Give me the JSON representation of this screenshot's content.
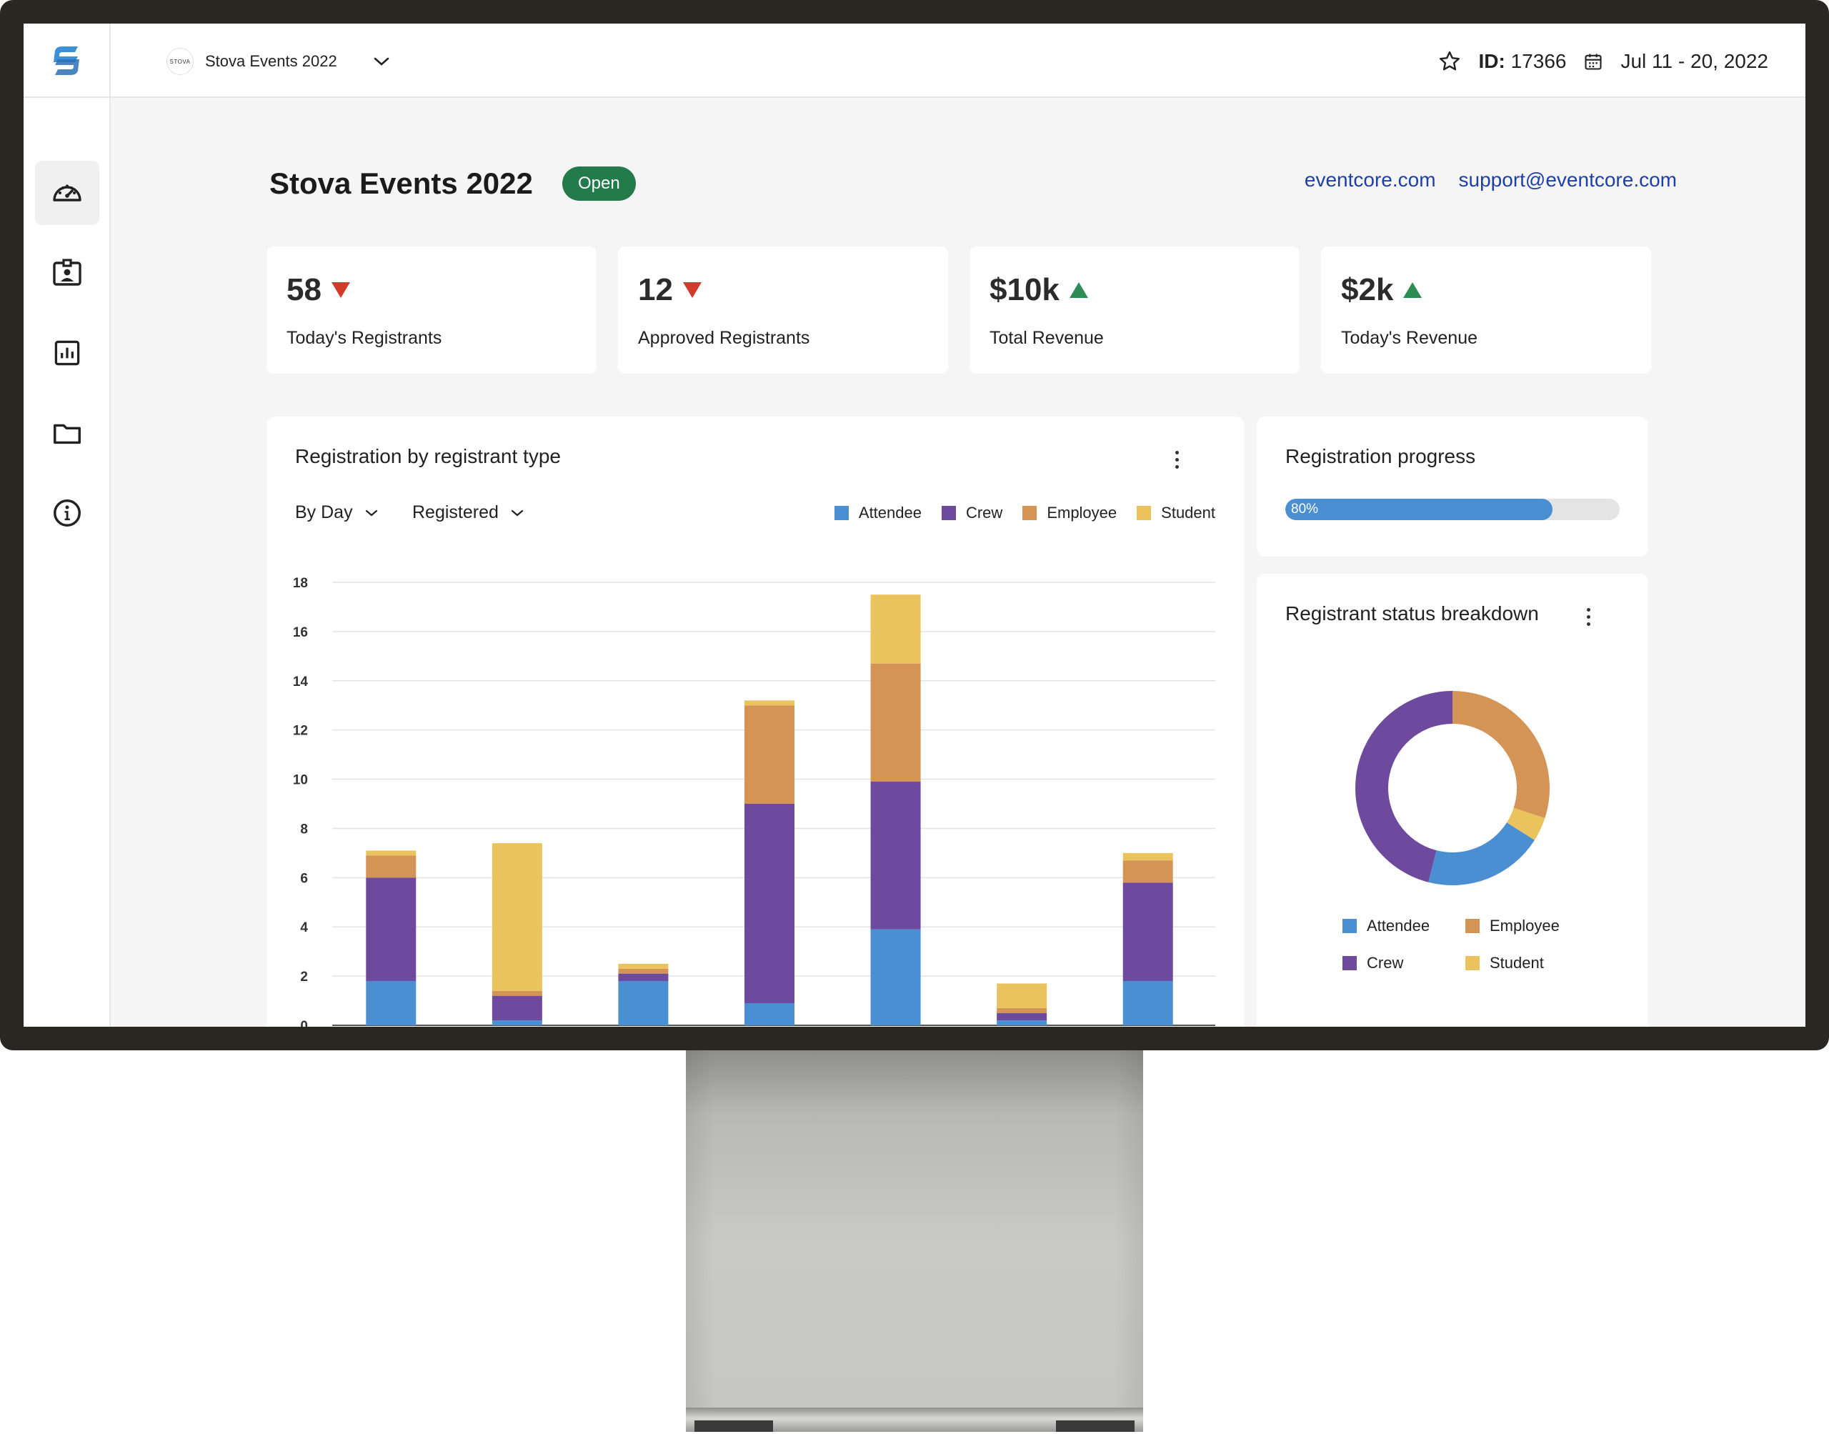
{
  "app": {
    "event_selector": {
      "logo_text": "STOVA",
      "label": "Stova Events 2022"
    },
    "id_label": "ID:",
    "id_value": "17366",
    "date_range": "Jul 11 - 20, 2022"
  },
  "sidebar": {
    "items": [
      {
        "icon": "dashboard-gauge-icon",
        "active": true
      },
      {
        "icon": "id-badge-icon",
        "active": false
      },
      {
        "icon": "report-chart-icon",
        "active": false
      },
      {
        "icon": "folder-icon",
        "active": false
      },
      {
        "icon": "info-icon",
        "active": false
      }
    ]
  },
  "header": {
    "title": "Stova Events 2022",
    "status": "Open",
    "links": [
      "eventcore.com",
      "support@eventcore.com"
    ]
  },
  "stats": [
    {
      "value": "58",
      "label": "Today's Registrants",
      "trend": "down"
    },
    {
      "value": "12",
      "label": "Approved Registrants",
      "trend": "down"
    },
    {
      "value": "$10k",
      "label": "Total Revenue",
      "trend": "up"
    },
    {
      "value": "$2k",
      "label": "Today's Revenue",
      "trend": "up"
    }
  ],
  "colors": {
    "attendee": "#4a8fd1",
    "crew": "#6e4a9e",
    "employee": "#d39456",
    "student": "#ebc35e",
    "trend_down": "#d23a2c",
    "trend_up": "#2f8c55",
    "status_open": "#237a4b",
    "link": "#1f3fa8"
  },
  "registration_card": {
    "title": "Registration by registrant type",
    "filter_period": "By Day",
    "filter_status": "Registered",
    "legend": [
      "Attendee",
      "Crew",
      "Employee",
      "Student"
    ]
  },
  "progress_card": {
    "title": "Registration progress",
    "percent": 80,
    "percent_label": "80%"
  },
  "status_card": {
    "title": "Registrant status breakdown",
    "legend": [
      "Attendee",
      "Employee",
      "Crew",
      "Student"
    ]
  },
  "chart_data": [
    {
      "type": "bar",
      "stacked": true,
      "title": "Registration by registrant type",
      "ylim": [
        0,
        18
      ],
      "yticks": [
        0,
        2,
        4,
        6,
        8,
        10,
        12,
        14,
        16,
        18
      ],
      "grid": true,
      "legend_position": "top-right",
      "series": [
        {
          "name": "Attendee",
          "color": "#4a8fd1",
          "values": [
            1.8,
            0.2,
            1.8,
            0.9,
            3.9,
            0.2,
            1.8
          ]
        },
        {
          "name": "Crew",
          "color": "#6e4a9e",
          "values": [
            4.2,
            1.0,
            0.3,
            8.1,
            6.0,
            0.3,
            4.0
          ]
        },
        {
          "name": "Employee",
          "color": "#d39456",
          "values": [
            0.9,
            0.2,
            0.2,
            4.0,
            4.8,
            0.2,
            0.9
          ]
        },
        {
          "name": "Student",
          "color": "#ebc35e",
          "values": [
            0.2,
            6.0,
            0.2,
            0.2,
            2.8,
            1.0,
            0.3
          ]
        }
      ]
    },
    {
      "type": "pie",
      "donut": true,
      "title": "Registrant status breakdown",
      "slices": [
        {
          "name": "Attendee",
          "color": "#4a8fd1",
          "value": 20
        },
        {
          "name": "Crew",
          "color": "#6e4a9e",
          "value": 46
        },
        {
          "name": "Employee",
          "color": "#d39456",
          "value": 30
        },
        {
          "name": "Student",
          "color": "#ebc35e",
          "value": 4
        }
      ]
    }
  ]
}
